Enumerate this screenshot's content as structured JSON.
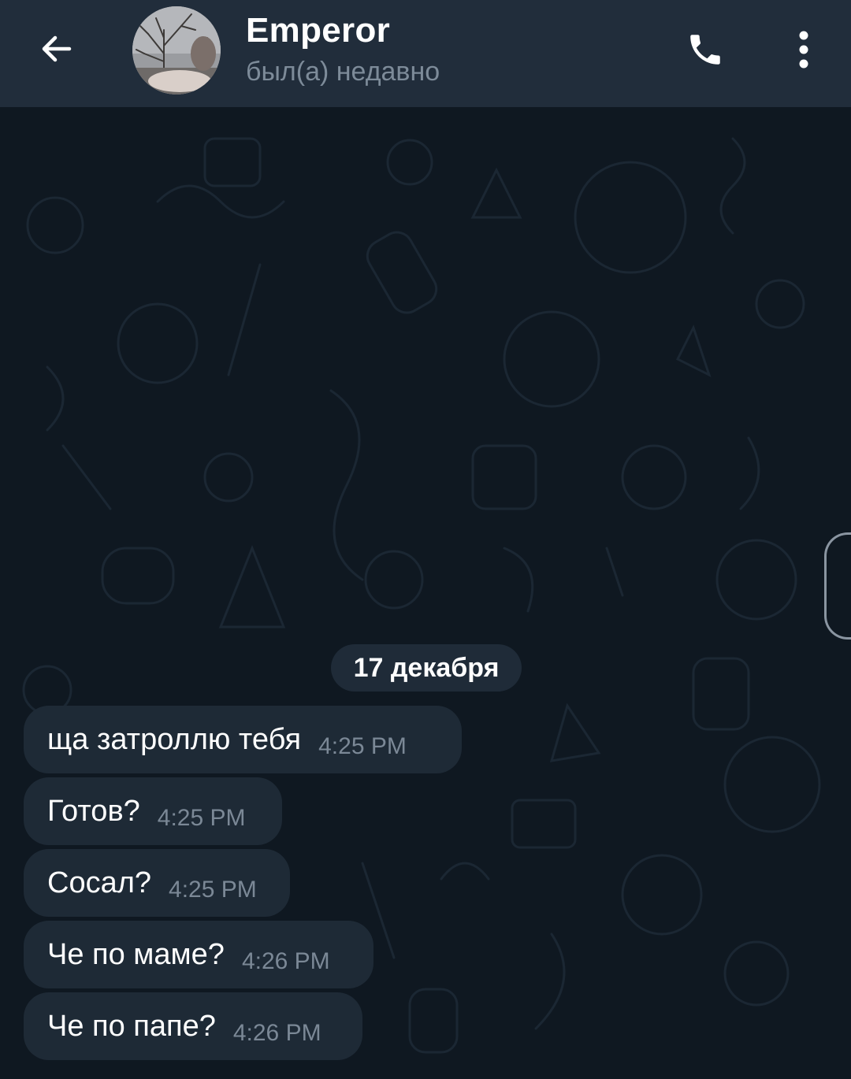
{
  "header": {
    "back_icon": "arrow-left-icon",
    "title": "Emperor",
    "status": "был(а) недавно",
    "call_icon": "phone-icon",
    "menu_icon": "more-vertical-icon"
  },
  "chat": {
    "date_separator": "17 декабря",
    "messages": [
      {
        "text": "ща затроллю тебя",
        "time": "4:25 PM"
      },
      {
        "text": "Готов?",
        "time": "4:25 PM"
      },
      {
        "text": "Сосал?",
        "time": "4:25 PM"
      },
      {
        "text": "Че по маме?",
        "time": "4:26 PM"
      },
      {
        "text": "Че по папе?",
        "time": "4:26 PM"
      }
    ]
  },
  "colors": {
    "header_bg": "#212d3b",
    "wallpaper_bg": "#0f1821",
    "bubble_bg": "#1e2a36",
    "status_text": "#7d8b99",
    "time_text": "#7b8896"
  }
}
